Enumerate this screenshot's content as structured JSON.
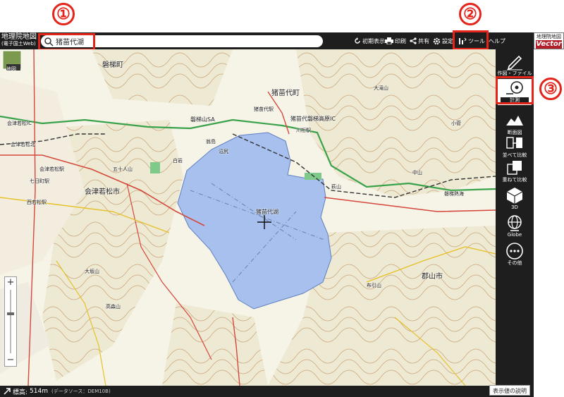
{
  "callouts": [
    "①",
    "②",
    "③"
  ],
  "app": {
    "title_line1": "地理院地図",
    "title_line2": "(電子国土Web)"
  },
  "search": {
    "value": "猪苗代湖"
  },
  "toolbar": {
    "reset_label": "初期表示",
    "print_label": "印刷",
    "share_label": "共有",
    "settings_label": "設定",
    "tools_label": "ツール",
    "help_label": "ヘルプ"
  },
  "brand": {
    "line1": "地理院地図",
    "line2": "Vector"
  },
  "rail": {
    "items": [
      {
        "label": "作図・ファイル"
      },
      {
        "label": "計測"
      },
      {
        "label": "断面図"
      },
      {
        "label": "並べて比較"
      },
      {
        "label": "重ねて比較"
      },
      {
        "label": "3D"
      },
      {
        "label": "Globe"
      },
      {
        "label": "その他"
      }
    ]
  },
  "map": {
    "badge_label": "地図",
    "labels": {
      "inawashiro_town": "猪苗代町",
      "bandai_town": "磐梯町",
      "aizuwakamatsu": "会津若松市",
      "koriyama": "郡山市",
      "lake": "猪苗代湖",
      "bandai_sa": "磐梯山SA",
      "inawashiro_ic": "猪苗代磐梯高原IC",
      "aizuwakamatsu_ic": "会津若松IC",
      "nishiwakamatsu": "西若松駅",
      "nanuka": "七日町駅",
      "aizuwakamatsu_st": "会津若松駅",
      "kawageta": "川桁駅",
      "inawashiro_st": "猪苗代駅",
      "numajiri": "沼尻",
      "tokinokura": "翁島",
      "shiramine": "白岩",
      "takamoriyama": "高森山",
      "osakayama": "大坂山",
      "nakayama": "中山",
      "ohyama": "大滝山",
      "hagiyama": "萩山",
      "nunohikiyama": "布引山",
      "kosuga": "小菅",
      "gojimai": "五十人山",
      "aizuki": "会津若松北",
      "bandaisan": "磐梯熱海"
    }
  },
  "elevation": {
    "label": "標高:",
    "value": "514m",
    "source": "(データソース：DEM10B)"
  },
  "legend_button": "表示値の説明",
  "colors": {
    "header_bg": "#1e1e1e",
    "callout_red": "#e3241b",
    "lake": "#a7c0ee",
    "brand_red": "#b3202a"
  }
}
